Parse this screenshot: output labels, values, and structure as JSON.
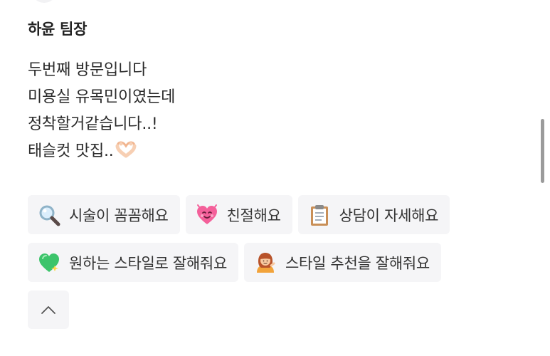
{
  "review": {
    "author": "하윤 팀장",
    "lines": [
      "두번째 방문입니다",
      "미용실 유목민이였는데",
      "정착할거같습니다..!",
      "태슬컷 맛집.."
    ],
    "line4_emoji": "heart-hands-icon"
  },
  "keywords": [
    {
      "icon": "magnifier-icon",
      "label": "시술이 꼼꼼해요"
    },
    {
      "icon": "smiling-heart-icon",
      "label": "친절해요"
    },
    {
      "icon": "clipboard-icon",
      "label": "상담이 자세해요"
    },
    {
      "icon": "green-heart-icon",
      "label": "원하는 스타일로 잘해줘요"
    },
    {
      "icon": "hairdresser-icon",
      "label": "스타일 추천을 잘해줘요"
    }
  ],
  "collapse": {
    "icon": "chevron-up-icon"
  },
  "colors": {
    "chip_background": "#f5f5f7",
    "text": "#222222",
    "scrollbar": "#9b9b9b"
  }
}
